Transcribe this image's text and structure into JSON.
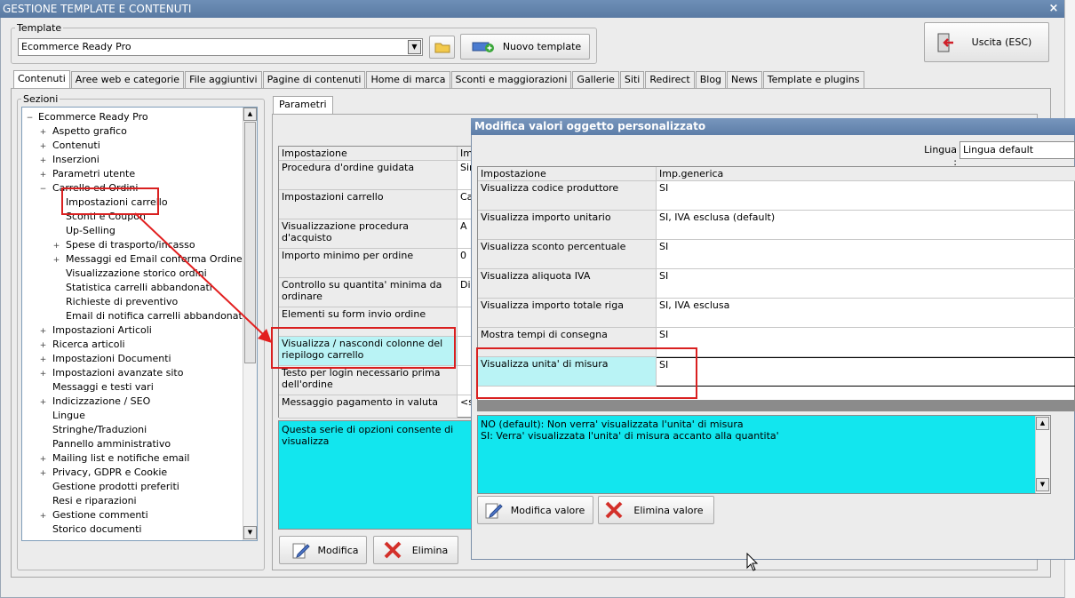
{
  "window": {
    "title": "GESTIONE TEMPLATE E CONTENUTI",
    "close": "×"
  },
  "template_group": {
    "legend": "Template",
    "selected": "Ecommerce Ready Pro",
    "new_button": "Nuovo template"
  },
  "exit_button": "Uscita (ESC)",
  "tabs": [
    "Contenuti",
    "Aree web e categorie",
    "File aggiuntivi",
    "Pagine di contenuti",
    "Home di marca",
    "Sconti e maggiorazioni",
    "Gallerie",
    "Siti",
    "Redirect",
    "Blog",
    "News",
    "Template e plugins"
  ],
  "sections": {
    "legend": "Sezioni",
    "root": "Ecommerce Ready Pro",
    "items": [
      {
        "label": "Aspetto grafico",
        "exp": "+"
      },
      {
        "label": "Contenuti",
        "exp": "+"
      },
      {
        "label": "Inserzioni",
        "exp": "+"
      },
      {
        "label": "Parametri utente",
        "exp": "+"
      },
      {
        "label": "Carrello ed Ordini",
        "exp": "−"
      },
      {
        "label": "Impostazioni carrello",
        "exp": ""
      },
      {
        "label": "Sconti e Coupon",
        "exp": ""
      },
      {
        "label": "Up-Selling",
        "exp": ""
      },
      {
        "label": "Spese di trasporto/incasso",
        "exp": "+"
      },
      {
        "label": "Messaggi ed Email conferma Ordine",
        "exp": "+"
      },
      {
        "label": "Visualizzazione storico ordini",
        "exp": ""
      },
      {
        "label": "Statistica carrelli abbandonati",
        "exp": ""
      },
      {
        "label": "Richieste di preventivo",
        "exp": ""
      },
      {
        "label": "Email di notifica carrelli abbandonati",
        "exp": ""
      },
      {
        "label": "Impostazioni Articoli",
        "exp": "+"
      },
      {
        "label": "Ricerca articoli",
        "exp": "+"
      },
      {
        "label": "Impostazioni Documenti",
        "exp": "+"
      },
      {
        "label": "Impostazioni avanzate sito",
        "exp": "+"
      },
      {
        "label": "Messaggi e testi vari",
        "exp": ""
      },
      {
        "label": "Indicizzazione / SEO",
        "exp": "+"
      },
      {
        "label": "Lingue",
        "exp": ""
      },
      {
        "label": "Stringhe/Traduzioni",
        "exp": ""
      },
      {
        "label": "Pannello amministrativo",
        "exp": ""
      },
      {
        "label": "Mailing list e notifiche email",
        "exp": "+"
      },
      {
        "label": "Privacy, GDPR e Cookie",
        "exp": "+"
      },
      {
        "label": "Gestione prodotti preferiti",
        "exp": ""
      },
      {
        "label": "Resi e riparazioni",
        "exp": ""
      },
      {
        "label": "Gestione commenti",
        "exp": "+"
      },
      {
        "label": "Storico documenti",
        "exp": ""
      }
    ]
  },
  "params": {
    "tab": "Parametri",
    "col_setting": "Impostazione",
    "col_value": "Imp",
    "rows": [
      {
        "label": "Procedura d'ordine guidata",
        "value": "Sin"
      },
      {
        "label": "Impostazioni carrello",
        "value": "Ca"
      },
      {
        "label": "Visualizzazione procedura d'acquisto",
        "value": "A"
      },
      {
        "label": "Importo minimo per ordine",
        "value": "0"
      },
      {
        "label": "Controllo su quantita' minima da ordinare",
        "value": "Dis"
      },
      {
        "label": "Elementi su form invio ordine",
        "value": ""
      },
      {
        "label": "Visualizza / nascondi colonne del riepilogo carrello",
        "value": ""
      },
      {
        "label": "Testo per login necessario prima dell'ordine",
        "value": ""
      },
      {
        "label": "Messaggio pagamento in valuta",
        "value": "<s"
      }
    ],
    "description": "Questa serie di opzioni consente di visualizza",
    "edit_button": "Modifica",
    "delete_button": "Elimina"
  },
  "dialog": {
    "title": "Modifica valori oggetto personalizzato",
    "lang_label": "Lingua :",
    "lang_value": "Lingua default",
    "col_setting": "Impostazione",
    "col_value": "Imp.generica",
    "rows": [
      {
        "label": "Visualizza codice produttore",
        "value": "SI"
      },
      {
        "label": "Visualizza importo unitario",
        "value": "SI, IVA esclusa (default)"
      },
      {
        "label": "Visualizza sconto percentuale",
        "value": "SI"
      },
      {
        "label": "Visualizza aliquota IVA",
        "value": "SI"
      },
      {
        "label": "Visualizza importo totale riga",
        "value": "SI, IVA esclusa"
      },
      {
        "label": "Mostra tempi di consegna",
        "value": "SI"
      },
      {
        "label": "Visualizza unita' di misura",
        "value": "SI"
      }
    ],
    "help_line1": "NO (default): Non verra' visualizzata l'unita' di misura",
    "help_line2": "SI: Verra' visualizzata l'unita' di misura accanto alla quantita'",
    "edit_value_button": "Modifica valore",
    "delete_value_button": "Elimina valore"
  },
  "colors": {
    "highlight_red": "#d92020",
    "cyan": "#12e6ee",
    "selected_row": "#b9f3f5",
    "titlebar": "#6a8bb3"
  }
}
